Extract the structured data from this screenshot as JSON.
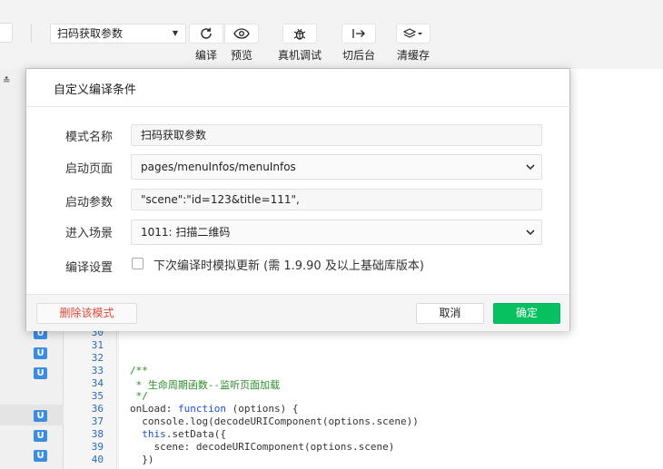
{
  "toolbar": {
    "mode_value": "扫码获取参数",
    "buttons": [
      {
        "label": "编译",
        "icon": "refresh-icon"
      },
      {
        "label": "预览",
        "icon": "eye-icon"
      },
      {
        "label": "真机调试",
        "icon": "bug-icon"
      },
      {
        "label": "切后台",
        "icon": "switch-background-icon"
      },
      {
        "label": "清缓存",
        "icon": "layers-icon"
      }
    ]
  },
  "gutter": {
    "top_icon": "≛",
    "badge": "U"
  },
  "editor": {
    "lines": [
      {
        "num": "30",
        "text": ""
      },
      {
        "num": "31",
        "text": ""
      },
      {
        "num": "32",
        "text": ""
      },
      {
        "num": "33",
        "text": "/**"
      },
      {
        "num": "34",
        "text": " * 生命周期函数--监听页面加载"
      },
      {
        "num": "35",
        "text": " */"
      },
      {
        "num": "36",
        "text_parts": [
          "onLoad: ",
          "function",
          " (options) {"
        ]
      },
      {
        "num": "37",
        "text": "  console.log(decodeURIComponent(options.scene))"
      },
      {
        "num": "38",
        "text_parts": [
          "  ",
          "this",
          ".setData({"
        ]
      },
      {
        "num": "39",
        "text": "    scene: decodeURIComponent(options.scene)"
      },
      {
        "num": "40",
        "text": "  })"
      }
    ]
  },
  "dialog": {
    "title": "自定义编译条件",
    "fields": {
      "mode_name": {
        "label": "模式名称",
        "value": "扫码获取参数"
      },
      "start_page": {
        "label": "启动页面",
        "value": "pages/menuInfos/menuInfos"
      },
      "start_params": {
        "label": "启动参数",
        "value": "\"scene\":\"id=123&title=111\","
      },
      "scene": {
        "label": "进入场景",
        "value": "1011: 扫描二维码"
      }
    },
    "compile_settings": {
      "label": "编译设置",
      "checkbox_text": "下次编译时模拟更新 (需 1.9.90 及以上基础库版本)"
    },
    "buttons": {
      "delete": "删除该模式",
      "cancel": "取消",
      "ok": "确定"
    }
  },
  "colors": {
    "accent_green": "#07c160",
    "danger_red": "#e0453a",
    "badge_blue": "#3c8de0",
    "comment_green": "#2c8c2c",
    "keyword_blue": "#1f4fd1"
  }
}
